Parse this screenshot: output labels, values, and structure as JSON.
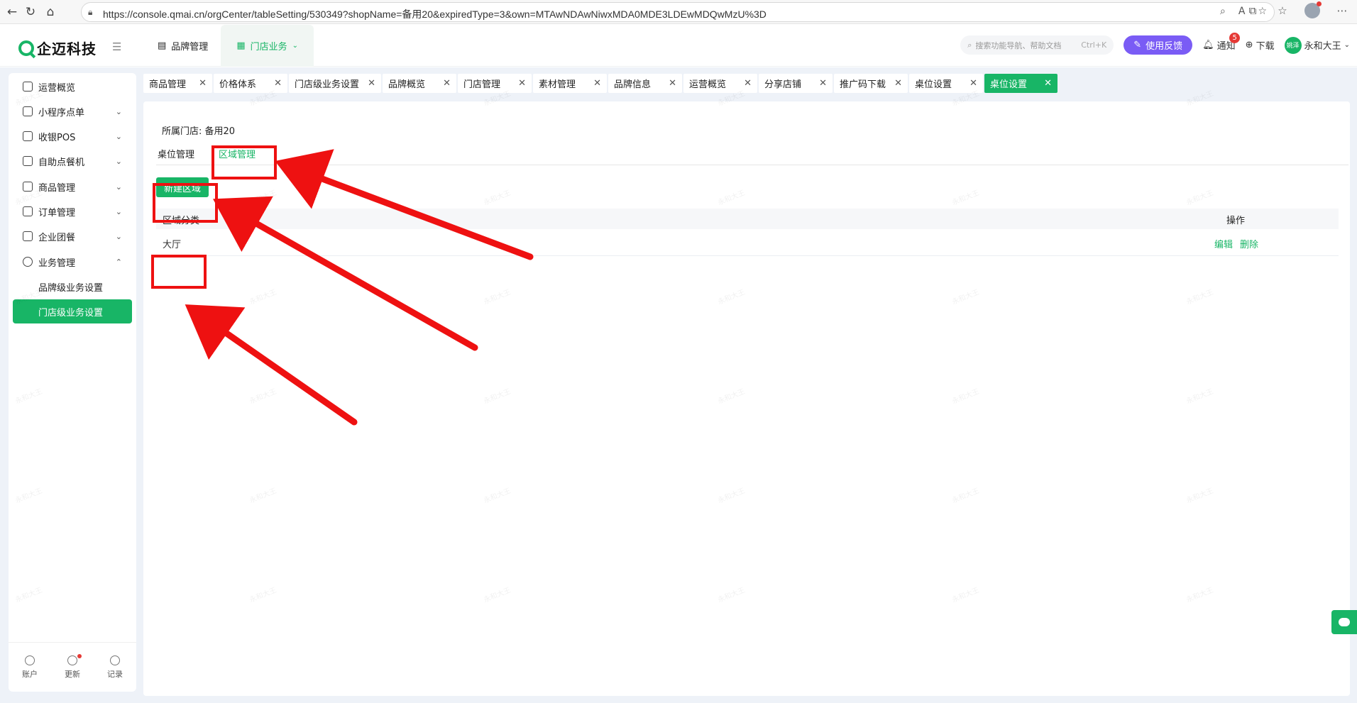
{
  "browser": {
    "url": "https://console.qmai.cn/orgCenter/tableSetting/530349?shopName=备用20&expiredType=3&own=MTAwNDAwNiwxMDA0MDE3LDEwMDQwMzU%3D"
  },
  "header": {
    "logo_text": "企迈科技",
    "nav": [
      {
        "label": "品牌管理"
      },
      {
        "label": "门店业务"
      }
    ],
    "search_placeholder": "搜索功能导航、帮助文档",
    "search_shortcut": "Ctrl+K",
    "feedback_label": "使用反馈",
    "notify_label": "通知",
    "notify_count": "5",
    "download_label": "下载",
    "user_avatar_text": "姚泽",
    "user_name": "永和大王"
  },
  "sidebar": {
    "items": [
      {
        "label": "运营概览"
      },
      {
        "label": "小程序点单"
      },
      {
        "label": "收银POS"
      },
      {
        "label": "自助点餐机"
      },
      {
        "label": "商品管理"
      },
      {
        "label": "订单管理"
      },
      {
        "label": "企业团餐"
      },
      {
        "label": "业务管理"
      }
    ],
    "sub_items": [
      {
        "label": "品牌级业务设置"
      },
      {
        "label": "门店级业务设置"
      }
    ],
    "footer": [
      {
        "label": "账户"
      },
      {
        "label": "更新"
      },
      {
        "label": "记录"
      }
    ]
  },
  "tabs": [
    {
      "label": "商品管理"
    },
    {
      "label": "价格体系"
    },
    {
      "label": "门店级业务设置"
    },
    {
      "label": "品牌概览"
    },
    {
      "label": "门店管理"
    },
    {
      "label": "素材管理"
    },
    {
      "label": "品牌信息"
    },
    {
      "label": "运营概览"
    },
    {
      "label": "分享店铺"
    },
    {
      "label": "推广码下载"
    },
    {
      "label": "桌位设置"
    },
    {
      "label": "桌位设置"
    }
  ],
  "content": {
    "shop_prefix": "所属门店:",
    "shop_name": "备用20",
    "subtabs": [
      {
        "label": "桌位管理"
      },
      {
        "label": "区域管理"
      }
    ],
    "new_button": "新建区域",
    "table": {
      "headers": {
        "area": "区域分类",
        "ops": "操作"
      },
      "rows": [
        {
          "area": "大厅",
          "edit": "编辑",
          "delete": "删除"
        }
      ]
    }
  },
  "watermark_text": "永和大王",
  "colors": {
    "accent": "#18b566",
    "feedback": "#7a5cf5",
    "annotation": "#ee1111"
  }
}
